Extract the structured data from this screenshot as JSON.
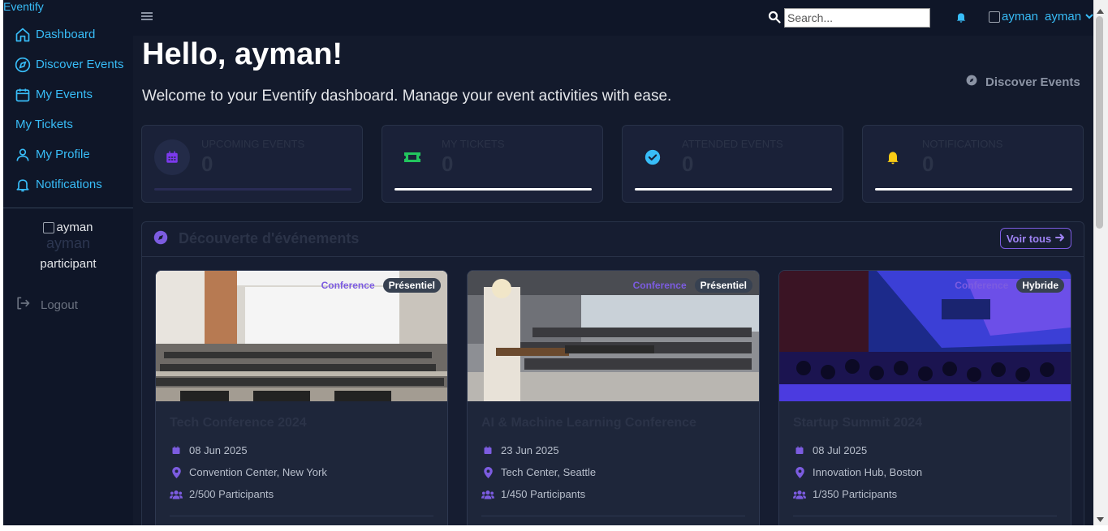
{
  "app": {
    "brand": "Eventify"
  },
  "sidebar": {
    "items": [
      {
        "label": "Dashboard",
        "icon": "home-icon"
      },
      {
        "label": "Discover Events",
        "icon": "compass-icon"
      },
      {
        "label": "My Events",
        "icon": "calendar-icon"
      },
      {
        "label": "My Tickets",
        "icon": ""
      },
      {
        "label": "My Profile",
        "icon": "user-icon"
      },
      {
        "label": "Notifications",
        "icon": "bell-icon"
      }
    ],
    "user_alt": "ayman",
    "user_name": "ayman",
    "user_role": "participant",
    "logout_label": "Logout"
  },
  "topbar": {
    "search_placeholder": "Search...",
    "user_alt": "ayman",
    "user_name": "ayman"
  },
  "main": {
    "greeting": "Hello, ayman!",
    "welcome": "Welcome to your Eventify dashboard. Manage your event activities with ease.",
    "discover_button": "Discover Events"
  },
  "stats": [
    {
      "label": "Upcoming Events",
      "value": "0",
      "icon": "calendar-icon",
      "color": "#7c3aed"
    },
    {
      "label": "My Tickets",
      "value": "0",
      "icon": "ticket-icon",
      "color": "#22c55e"
    },
    {
      "label": "Attended Events",
      "value": "0",
      "icon": "check-circle-icon",
      "color": "#38bdf8"
    },
    {
      "label": "Notifications",
      "value": "0",
      "icon": "bell-icon",
      "color": "#facc15"
    }
  ],
  "discovery": {
    "title": "Découverte d'événements",
    "see_all": "Voir tous",
    "cards": [
      {
        "type": "Conference",
        "mode": "Présentiel",
        "title": "Tech Conference 2024",
        "date": "08 Jun 2025",
        "location": "Convention Center, New York",
        "participants": "2/500 Participants"
      },
      {
        "type": "Conference",
        "mode": "Présentiel",
        "title": "AI & Machine Learning Conference",
        "date": "23 Jun 2025",
        "location": "Tech Center, Seattle",
        "participants": "1/450 Participants"
      },
      {
        "type": "Conference",
        "mode": "Hybride",
        "title": "Startup Summit 2024",
        "date": "08 Jul 2025",
        "location": "Innovation Hub, Boston",
        "participants": "1/350 Participants"
      }
    ]
  },
  "colors": {
    "accent": "#38bdf8",
    "purple": "#7c5ce0",
    "background": "#131a2c"
  }
}
